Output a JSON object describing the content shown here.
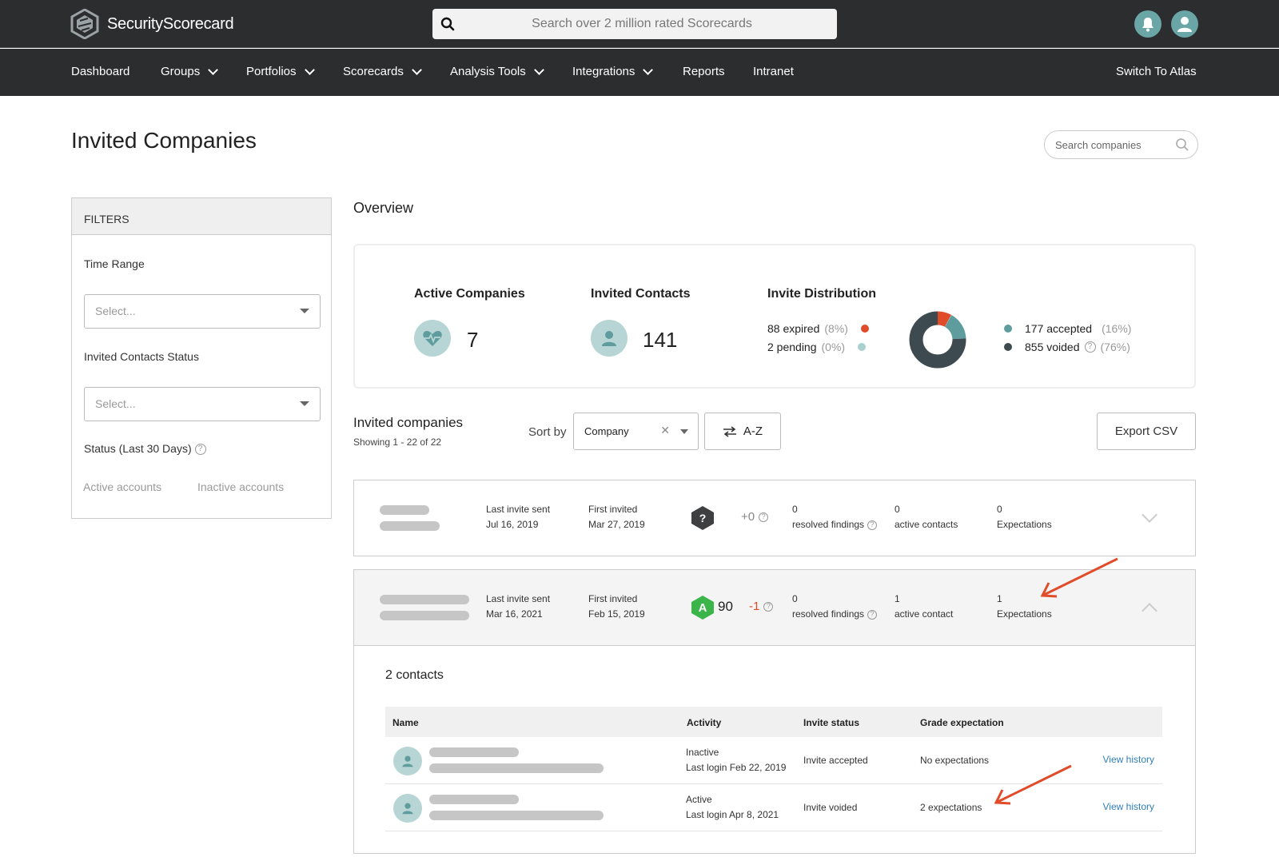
{
  "app": {
    "name": "SecurityScorecard",
    "top_search_placeholder": "Search over 2 million rated Scorecards"
  },
  "nav": {
    "items": [
      {
        "label": "Dashboard",
        "dropdown": false
      },
      {
        "label": "Groups",
        "dropdown": true
      },
      {
        "label": "Portfolios",
        "dropdown": true
      },
      {
        "label": "Scorecards",
        "dropdown": true
      },
      {
        "label": "Analysis Tools",
        "dropdown": true
      },
      {
        "label": "Integrations",
        "dropdown": true
      },
      {
        "label": "Reports",
        "dropdown": false
      },
      {
        "label": "Intranet",
        "dropdown": false
      }
    ],
    "switch_label": "Switch To Atlas"
  },
  "page": {
    "title": "Invited Companies",
    "search_placeholder": "Search companies"
  },
  "filters": {
    "header": "FILTERS",
    "time_range_label": "Time Range",
    "time_range_placeholder": "Select...",
    "contacts_status_label": "Invited Contacts Status",
    "contacts_status_placeholder": "Select...",
    "status_label": "Status (Last 30 Days)",
    "active_link": "Active accounts",
    "inactive_link": "Inactive accounts"
  },
  "overview": {
    "title": "Overview",
    "active_companies_label": "Active Companies",
    "active_companies_value": "7",
    "invited_contacts_label": "Invited Contacts",
    "invited_contacts_value": "141",
    "distribution_label": "Invite Distribution",
    "distribution": [
      {
        "text": "88 expired",
        "pct": "(8%)",
        "color": "#e04b2a",
        "fraction": 0.08
      },
      {
        "text": "2 pending",
        "pct": "(0%)",
        "color": "#a9cfcf",
        "fraction": 0.002
      },
      {
        "text": "177 accepted",
        "pct": "(16%)",
        "color": "#5e9c9e",
        "fraction": 0.16
      },
      {
        "text": "855 voided",
        "pct": "(76%)",
        "color": "#3d4a50",
        "fraction": 0.758
      }
    ]
  },
  "list": {
    "title": "Invited companies",
    "showing": "Showing 1 - 22 of 22",
    "sort_by_label": "Sort by",
    "sort_value": "Company",
    "order_label": "A-Z",
    "export_label": "Export CSV"
  },
  "companies": [
    {
      "last_invite_label": "Last invite sent",
      "last_invite_date": "Jul 16, 2019",
      "first_invited_label": "First invited",
      "first_invited_date": "Mar 27, 2019",
      "grade": "?",
      "grade_color": "#3d3f41",
      "score": "",
      "delta": "+0",
      "delta_color": "#888888",
      "resolved_value": "0",
      "resolved_label": "resolved findings",
      "contacts_value": "0",
      "contacts_label": "active contacts",
      "expectations_value": "0",
      "expectations_label": "Expectations"
    },
    {
      "last_invite_label": "Last invite sent",
      "last_invite_date": "Mar 16, 2021",
      "first_invited_label": "First invited",
      "first_invited_date": "Feb 15, 2019",
      "grade": "A",
      "grade_color": "#3bb54a",
      "score": "90",
      "delta": "-1",
      "delta_color": "#e04b2a",
      "resolved_value": "0",
      "resolved_label": "resolved findings",
      "contacts_value": "1",
      "contacts_label": "active contact",
      "expectations_value": "1",
      "expectations_label": "Expectations"
    }
  ],
  "contacts": {
    "count_label": "2 contacts",
    "headers": [
      "Name",
      "Activity",
      "Invite status",
      "Grade expectation"
    ],
    "rows": [
      {
        "activity": "Inactive",
        "last_login": "Last login Feb 22, 2019",
        "invite_status": "Invite accepted",
        "grade_expectation": "No expectations",
        "action": "View history"
      },
      {
        "activity": "Active",
        "last_login": "Last login Apr 8, 2021",
        "invite_status": "Invite voided",
        "grade_expectation": "2 expectations",
        "action": "View history"
      }
    ]
  },
  "colors": {
    "header_bg": "#2b2d2f",
    "accent": "#6aa6a6",
    "annotation_arrow": "#e04b2a",
    "link": "#2f7fb8"
  }
}
